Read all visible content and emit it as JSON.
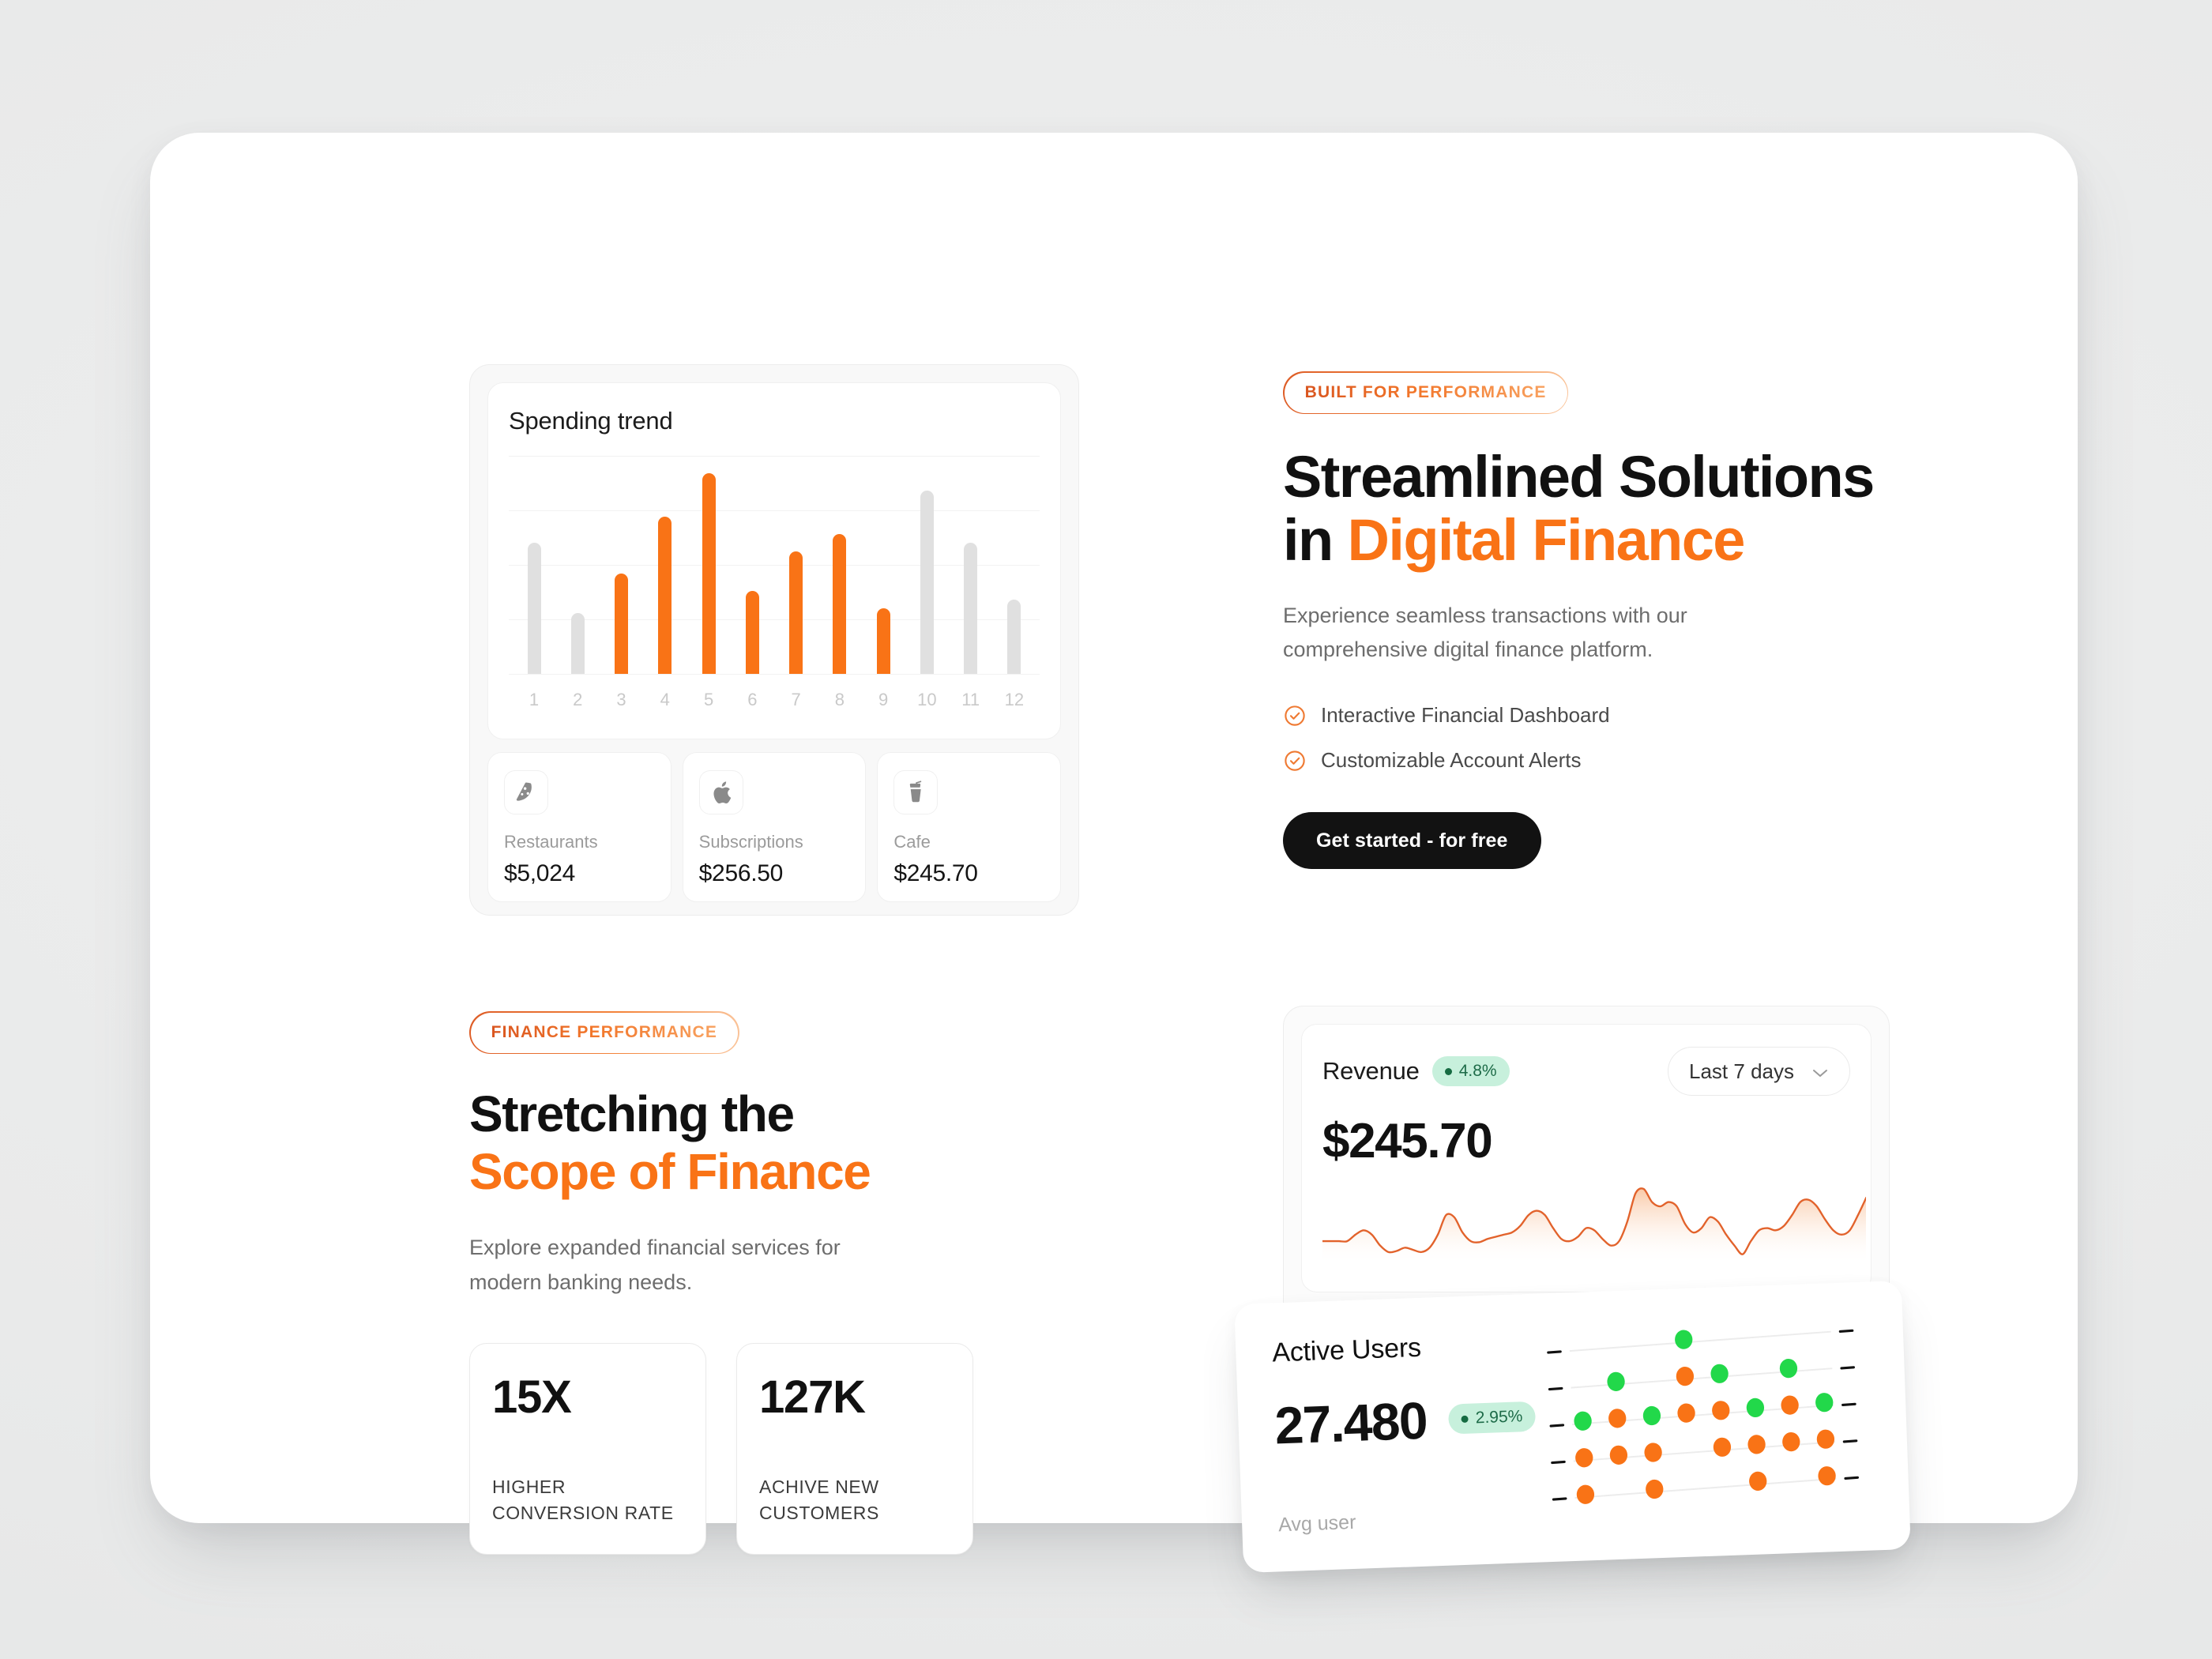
{
  "spending_panel": {
    "chart_title": "Spending trend",
    "categories": [
      {
        "icon": "pizza-icon",
        "name": "Restaurants",
        "value": "$5,024"
      },
      {
        "icon": "apple-icon",
        "name": "Subscriptions",
        "value": "$256.50"
      },
      {
        "icon": "drink-icon",
        "name": "Cafe",
        "value": "$245.70"
      }
    ]
  },
  "hero": {
    "badge": "BUILT FOR PERFORMANCE",
    "title_line1": "Streamlined Solutions",
    "title_line2_plain": "in ",
    "title_line2_accent": "Digital Finance",
    "subtitle": "Experience seamless transactions with our comprehensive digital finance platform.",
    "features": [
      "Interactive Financial Dashboard",
      "Customizable Account Alerts"
    ],
    "cta_label": "Get started - for free"
  },
  "lower_left": {
    "badge": "FINANCE PERFORMANCE",
    "title_line1": "Stretching the",
    "title_line2_accent": "Scope of Finance",
    "subtitle": "Explore expanded financial services for modern banking needs.",
    "stats": [
      {
        "number": "15X",
        "label": "HIGHER CONVERSION RATE"
      },
      {
        "number": "127K",
        "label": "ACHIVE NEW CUSTOMERS"
      }
    ]
  },
  "revenue_card": {
    "title": "Revenue",
    "change_badge": "4.8%",
    "period_label": "Last 7 days",
    "value": "$245.70"
  },
  "active_users_card": {
    "title": "Active Users",
    "value": "27.480",
    "change_badge": "2.95%",
    "footnote": "Avg user"
  },
  "colors": {
    "accent_orange": "#f97316",
    "accent_orange_dark": "#dd5c26",
    "bar_grey": "#e0e0e0",
    "badge_green_bg": "#c7f0dc",
    "badge_green_text": "#1d6b48",
    "dot_green": "#22d84a",
    "dot_orange": "#f97316",
    "cta_black": "#121212",
    "page_bg": "#eceded",
    "panel_bg": "#ffffff"
  },
  "chart_data": [
    {
      "type": "bar",
      "title": "Spending trend",
      "categories": [
        "1",
        "2",
        "3",
        "4",
        "5",
        "6",
        "7",
        "8",
        "9",
        "10",
        "11",
        "12"
      ],
      "values": [
        60,
        28,
        46,
        72,
        92,
        38,
        56,
        64,
        30,
        84,
        60,
        34
      ],
      "highlighted": [
        false,
        false,
        true,
        true,
        true,
        true,
        true,
        true,
        true,
        false,
        false,
        false
      ],
      "highlight_color": "#f97316",
      "base_color": "#e0e0e0",
      "xlabel": "",
      "ylabel": "",
      "ylim": [
        0,
        100
      ],
      "grid": true,
      "gridlines": 5,
      "legend": "none"
    },
    {
      "type": "area",
      "title": "Revenue",
      "value_label": "$245.70",
      "period": "Last 7 days",
      "change_pct": 4.8,
      "line_color": "#e2622b",
      "fill_gradient": [
        "#fbddc8",
        "#ffffff"
      ],
      "x": [
        0,
        2,
        4,
        6,
        8,
        10,
        12,
        14,
        16,
        18,
        20,
        22,
        24,
        26,
        28,
        30,
        32,
        34,
        36,
        38,
        40,
        42,
        44,
        46,
        48,
        50,
        52,
        54,
        56,
        58,
        60,
        62,
        64,
        66,
        68,
        70,
        72,
        74,
        76,
        78,
        80,
        82,
        84,
        86,
        88,
        90,
        92,
        94,
        96,
        98,
        100
      ],
      "y": [
        34,
        34,
        34,
        34,
        40,
        44,
        40,
        30,
        24,
        25,
        28,
        26,
        24,
        28,
        40,
        58,
        56,
        42,
        34,
        33,
        36,
        38,
        40,
        42,
        48,
        58,
        62,
        58,
        46,
        36,
        34,
        38,
        46,
        44,
        36,
        30,
        34,
        52,
        78,
        82,
        70,
        66,
        70,
        66,
        50,
        42,
        46,
        56,
        52,
        40,
        30,
        22,
        34,
        44,
        46,
        44,
        48,
        58,
        70,
        72,
        66,
        54,
        44,
        40,
        44,
        58,
        74
      ]
    },
    {
      "type": "scatter",
      "title": "Active Users",
      "value_label": "27.480",
      "change_pct": 2.95,
      "footnote": "Avg user",
      "rows": 5,
      "columns": 8,
      "row_dots": [
        [
          null,
          null,
          null,
          "green",
          null,
          null,
          null,
          null
        ],
        [
          null,
          "green",
          null,
          "orange",
          "green",
          null,
          "green",
          null
        ],
        [
          "green",
          "orange",
          "green",
          "orange",
          "orange",
          "green",
          "orange",
          "green"
        ],
        [
          "orange",
          "orange",
          "orange",
          null,
          "orange",
          "orange",
          "orange",
          "orange"
        ],
        [
          "orange",
          null,
          "orange",
          null,
          null,
          "orange",
          null,
          "orange"
        ]
      ],
      "colors": {
        "green": "#22d84a",
        "orange": "#f97316"
      }
    }
  ]
}
